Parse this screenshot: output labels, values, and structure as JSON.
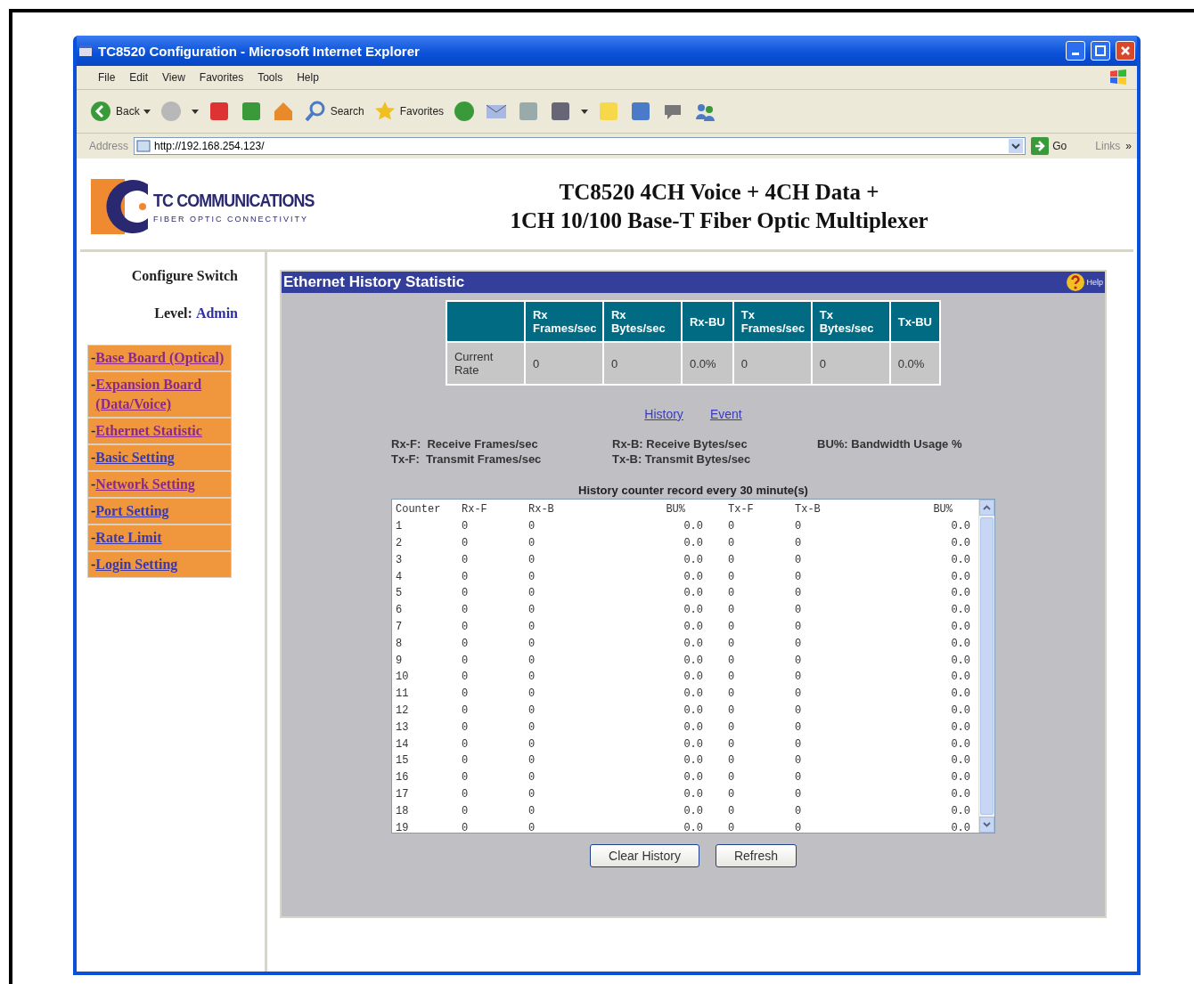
{
  "window": {
    "title": "TC8520 Configuration - Microsoft Internet Explorer"
  },
  "menu": [
    "File",
    "Edit",
    "View",
    "Favorites",
    "Tools",
    "Help"
  ],
  "toolbar": {
    "back": "Back",
    "search": "Search",
    "favorites": "Favorites"
  },
  "address_bar": {
    "label": "Address",
    "url": "http://192.168.254.123/",
    "go": "Go",
    "links": "Links",
    "more": "»"
  },
  "header": {
    "logo_name": "TC COMMUNICATIONS",
    "logo_tagline": "FIBER OPTIC CONNECTIVITY",
    "title_lines": [
      "TC8520 4CH Voice + 4CH Data +",
      "1CH 10/100 Base-T Fiber Optic Multiplexer"
    ]
  },
  "sidebar": {
    "heading": "Configure Switch",
    "level_label": "Level:",
    "level_value": "Admin",
    "items": [
      {
        "dash": "-",
        "label": "Base Board (Optical)",
        "visited": true
      },
      {
        "dash": "-",
        "label": "Expansion Board (Data/Voice)",
        "visited": true
      },
      {
        "dash": "-",
        "label": "Ethernet Statistic",
        "visited": true
      },
      {
        "dash": "-",
        "label": "Basic Setting",
        "visited": false
      },
      {
        "dash": "-",
        "label": "Network Setting",
        "visited": true
      },
      {
        "dash": "-",
        "label": "Port Setting",
        "visited": false
      },
      {
        "dash": "-",
        "label": "Rate Limit",
        "visited": false
      },
      {
        "dash": "-",
        "label": "Login Setting",
        "visited": false
      }
    ]
  },
  "panel": {
    "title": "Ethernet History Statistic",
    "help": "Help",
    "rate_table": {
      "columns": [
        "Rx Frames/sec",
        "Rx Bytes/sec",
        "Rx-BU",
        "Tx Frames/sec",
        "Tx Bytes/sec",
        "Tx-BU"
      ],
      "rows": [
        {
          "label": "Current Rate",
          "cells": [
            "0",
            "0",
            "0.0%",
            "0",
            "0",
            "0.0%"
          ]
        }
      ]
    },
    "links": [
      "History",
      "Event"
    ],
    "legend": [
      "Rx-F:  Receive Frames/sec",
      "Rx-B: Receive Bytes/sec",
      "BU%: Bandwidth Usage %",
      "Tx-F:  Transmit Frames/sec",
      "Tx-B: Transmit Bytes/sec"
    ],
    "history": {
      "caption": "History counter record every 30 minute(s)",
      "columns": [
        "Counter",
        "Rx-F",
        "Rx-B",
        "BU%",
        "Tx-F",
        "Tx-B",
        "BU%"
      ],
      "rows": [
        [
          "1",
          "0",
          "0",
          "0.0",
          "0",
          "0",
          "0.0"
        ],
        [
          "2",
          "0",
          "0",
          "0.0",
          "0",
          "0",
          "0.0"
        ],
        [
          "3",
          "0",
          "0",
          "0.0",
          "0",
          "0",
          "0.0"
        ],
        [
          "4",
          "0",
          "0",
          "0.0",
          "0",
          "0",
          "0.0"
        ],
        [
          "5",
          "0",
          "0",
          "0.0",
          "0",
          "0",
          "0.0"
        ],
        [
          "6",
          "0",
          "0",
          "0.0",
          "0",
          "0",
          "0.0"
        ],
        [
          "7",
          "0",
          "0",
          "0.0",
          "0",
          "0",
          "0.0"
        ],
        [
          "8",
          "0",
          "0",
          "0.0",
          "0",
          "0",
          "0.0"
        ],
        [
          "9",
          "0",
          "0",
          "0.0",
          "0",
          "0",
          "0.0"
        ],
        [
          "10",
          "0",
          "0",
          "0.0",
          "0",
          "0",
          "0.0"
        ],
        [
          "11",
          "0",
          "0",
          "0.0",
          "0",
          "0",
          "0.0"
        ],
        [
          "12",
          "0",
          "0",
          "0.0",
          "0",
          "0",
          "0.0"
        ],
        [
          "13",
          "0",
          "0",
          "0.0",
          "0",
          "0",
          "0.0"
        ],
        [
          "14",
          "0",
          "0",
          "0.0",
          "0",
          "0",
          "0.0"
        ],
        [
          "15",
          "0",
          "0",
          "0.0",
          "0",
          "0",
          "0.0"
        ],
        [
          "16",
          "0",
          "0",
          "0.0",
          "0",
          "0",
          "0.0"
        ],
        [
          "17",
          "0",
          "0",
          "0.0",
          "0",
          "0",
          "0.0"
        ],
        [
          "18",
          "0",
          "0",
          "0.0",
          "0",
          "0",
          "0.0"
        ],
        [
          "19",
          "0",
          "0",
          "0.0",
          "0",
          "0",
          "0.0"
        ]
      ]
    },
    "buttons": [
      "Clear History",
      "Refresh"
    ]
  }
}
